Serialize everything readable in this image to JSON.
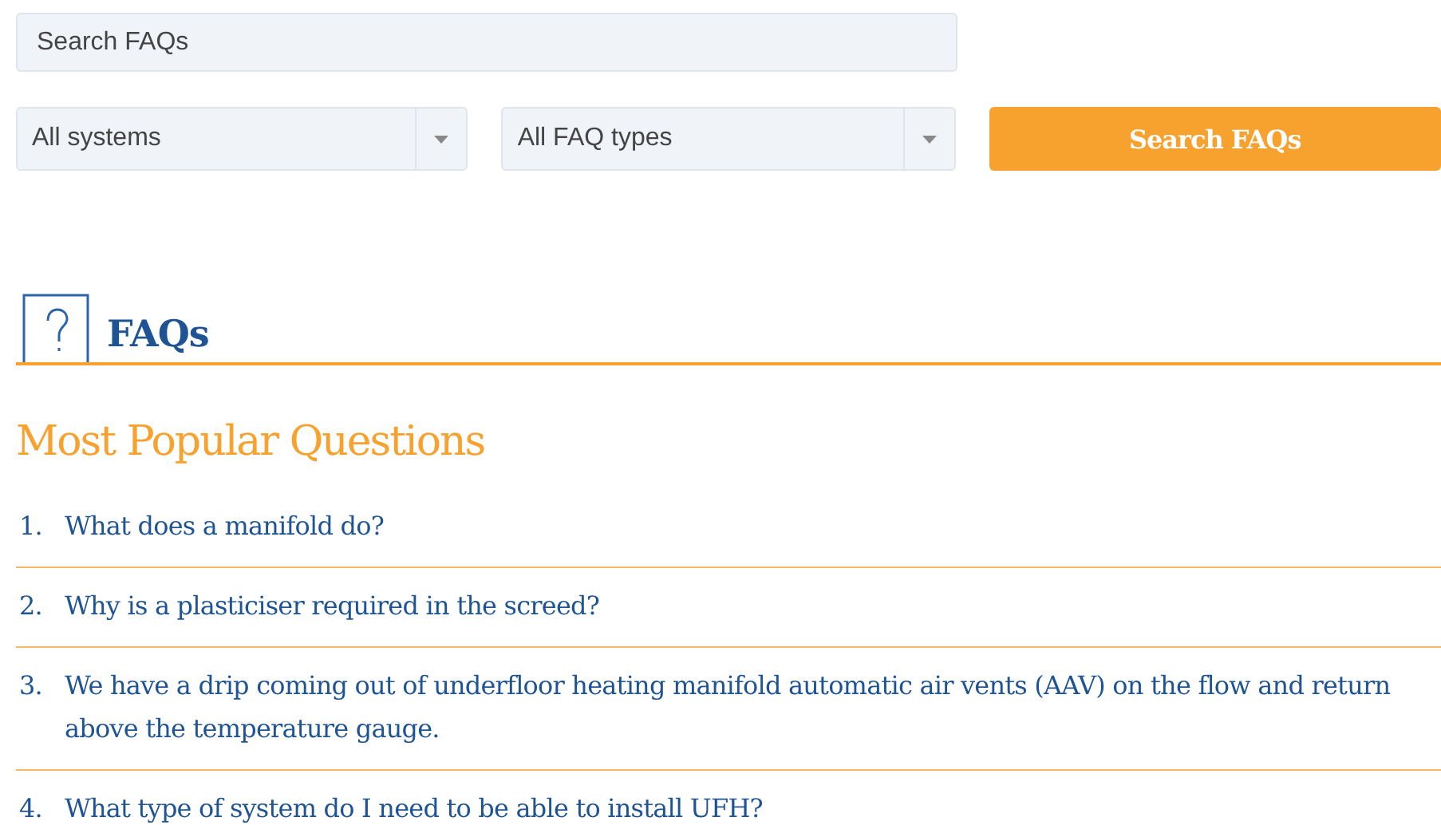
{
  "search": {
    "placeholder": "Search FAQs"
  },
  "filters": [
    {
      "value": "All systems"
    },
    {
      "value": "All FAQ types"
    }
  ],
  "search_button": {
    "label": "Search FAQs"
  },
  "section_title": "FAQs",
  "popular_heading": "Most Popular Questions",
  "questions": [
    {
      "number": "1.",
      "text": "What does a manifold do?"
    },
    {
      "number": "2.",
      "text": "Why is a plasticiser required in the screed?"
    },
    {
      "number": "3.",
      "text": "We have a drip coming out of underfloor heating manifold automatic air vents (AAV) on the flow and return above the temperature gauge."
    },
    {
      "number": "4.",
      "text": "What type of system do I need to be able to install UFH?"
    }
  ]
}
